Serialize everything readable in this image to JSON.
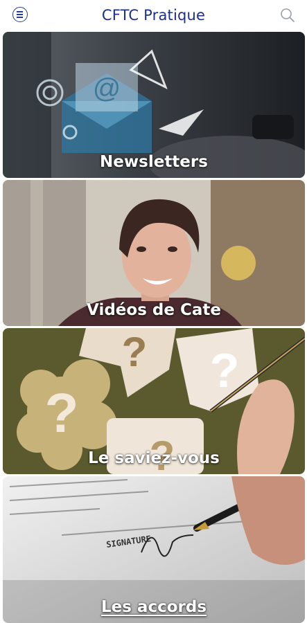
{
  "app": {
    "title": "CFTC Pratique"
  },
  "header": {
    "menu_icon": "menu-icon",
    "search_icon": "search-icon"
  },
  "cards": [
    {
      "label": "Newsletters"
    },
    {
      "label": "Vidéos de Cate"
    },
    {
      "label": "Le saviez-vous"
    },
    {
      "label": "Les accords"
    }
  ],
  "colors": {
    "brand": "#1f2f86"
  }
}
